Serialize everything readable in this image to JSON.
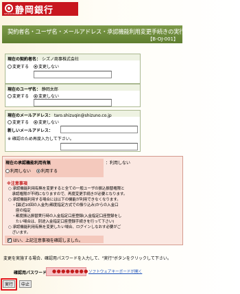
{
  "header": {
    "bank_name": "静岡銀行",
    "logo_sub": "SHIZUOKA BANK",
    "page_title": "契約者名・ユーザ名・メールアドレス・承認機能利用変更手続きの実行",
    "page_code": "【B-OJ-001】",
    "colors": {
      "brand": "#c8161e",
      "title_bar": "#6b8a3a"
    }
  },
  "contract": {
    "label": "現在の契約者名：",
    "value": "シズノ商事株式会社",
    "options": [
      "変更する",
      "変更しない"
    ],
    "selected": "変更しない"
  },
  "user": {
    "label": "現在のユーザ名：",
    "value": "静岡太郎",
    "options": [
      "変更する",
      "変更しない"
    ],
    "selected": "変更しない"
  },
  "email": {
    "label": "現在のメールアドレス：",
    "value": "taro.shizuqin@shizuno.co.jp",
    "options": [
      "変更する",
      "変更しない"
    ],
    "selected": "変更しない",
    "new_label": "新しいメールアドレス：",
    "confirm_note": "※ 確認のため再度入力して下さい。"
  },
  "approval": {
    "label": "現在の承認機能利用有無",
    "current_value": "：利用しない",
    "options": [
      "利用しない",
      "利用する"
    ],
    "selected": "利用する",
    "notice_title": "※注意事項",
    "notice_lines": [
      "○ 承認機能利用有無を変更すると全ての一般ユーザの振込振替権限と",
      "　承認権限が不明になりますので、再度変更手続きが必要となります。",
      "○ 承認機能利用する場合には以下の機能が利用できなくなります。",
      "　・【最近10回の入金先(都度指定方式での振り込み)からの入金口",
      "　　座の指定",
      "　・都度振込振替実行時の入金指定口座登録(入金指定口座登録をし",
      "　　たい場合は、別途入金指定口座登録手続きを行って下さい)",
      "○ 承認機能利用有無を変更したい場合、ログインしなおす必要がご",
      "　ざいます。"
    ],
    "confirm_label": "はい、上記注意事項を確認しました。",
    "confirm_checked": true
  },
  "footer": {
    "instruction": "変更を実施する場合、確認用パスワードを入力して、\"実行\"ボタンをクリックして下さい。",
    "password_label": "確認用パスワード：",
    "password_mask": "●●●●●●●●",
    "keyboard_link": "ソフトウェアキーボードが開く",
    "execute_label": "実行",
    "cancel_label": "中止"
  }
}
